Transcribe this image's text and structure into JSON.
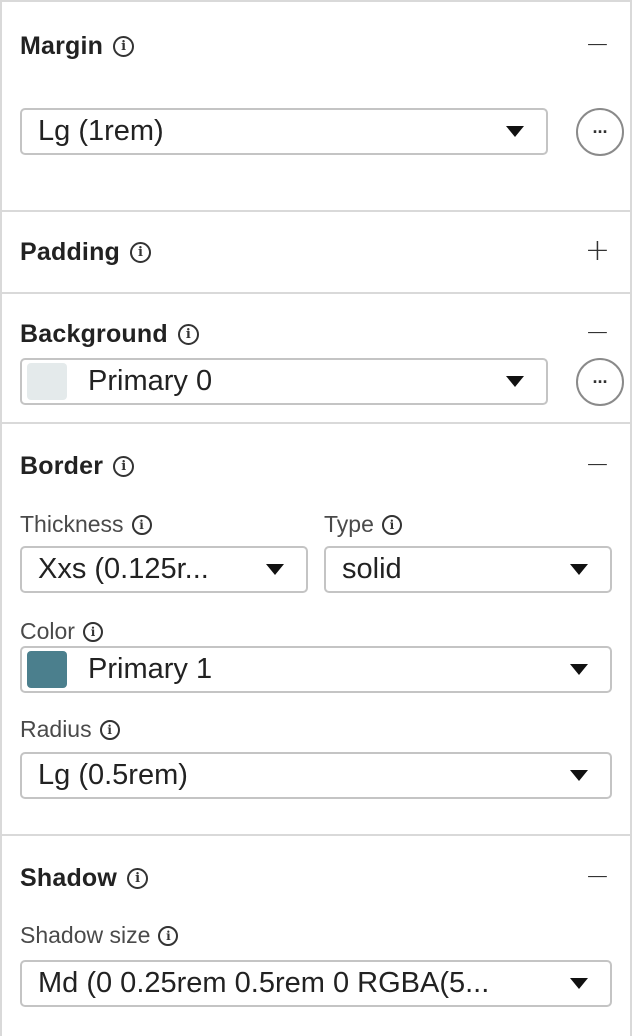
{
  "margin": {
    "title": "Margin",
    "toggle": "−",
    "value": "Lg (1rem)",
    "more": "···"
  },
  "padding": {
    "title": "Padding",
    "toggle": "+"
  },
  "background": {
    "title": "Background",
    "toggle": "−",
    "value": "Primary 0",
    "swatch_color": "#e4eaeb",
    "more": "···"
  },
  "border": {
    "title": "Border",
    "toggle": "−",
    "thickness_label": "Thickness",
    "thickness_value": "Xxs (0.125r...",
    "type_label": "Type",
    "type_value": "solid",
    "color_label": "Color",
    "color_value": "Primary 1",
    "color_swatch": "#4b7f8d",
    "radius_label": "Radius",
    "radius_value": "Lg (0.5rem)"
  },
  "shadow": {
    "title": "Shadow",
    "toggle": "−",
    "size_label": "Shadow size",
    "size_value": "Md (0 0.25rem 0.5rem 0 RGBA(5..."
  },
  "icons": {
    "info": "i"
  }
}
